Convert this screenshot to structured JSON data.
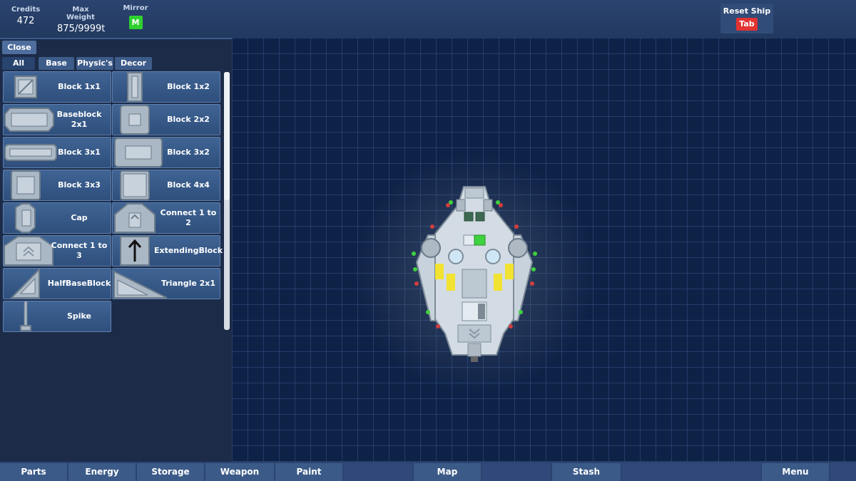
{
  "topbar": {
    "credits_label": "Credits",
    "credits_value": "472",
    "weight_label": "Max Weight",
    "weight_value": "875/9999t",
    "mirror_label": "Mirror",
    "mirror_key": "M",
    "mirror_color": "#2fd12f",
    "reset_label": "Reset Ship",
    "reset_key": "Tab",
    "reset_color": "#e23232"
  },
  "panel": {
    "close_label": "Close",
    "tabs": [
      "All",
      "Base",
      "Physic's",
      "Decor"
    ],
    "active_tab": "All",
    "parts": [
      {
        "label": "Block 1x1",
        "icon": "block-1x1-icon"
      },
      {
        "label": "Block 1x2",
        "icon": "block-1x2-icon"
      },
      {
        "label": "Baseblock 2x1",
        "icon": "baseblock-2x1-icon"
      },
      {
        "label": "Block 2x2",
        "icon": "block-2x2-icon"
      },
      {
        "label": "Block 3x1",
        "icon": "block-3x1-icon"
      },
      {
        "label": "Block 3x2",
        "icon": "block-3x2-icon"
      },
      {
        "label": "Block 3x3",
        "icon": "block-3x3-icon"
      },
      {
        "label": "Block 4x4",
        "icon": "block-4x4-icon"
      },
      {
        "label": "Cap",
        "icon": "cap-icon"
      },
      {
        "label": "Connect 1 to 2",
        "icon": "connect-1-to-2-icon"
      },
      {
        "label": "Connect 1 to 3",
        "icon": "connect-1-to-3-icon"
      },
      {
        "label": "ExtendingBlock",
        "icon": "extending-block-icon"
      },
      {
        "label": "HalfBaseBlock",
        "icon": "half-base-block-icon"
      },
      {
        "label": "Triangle 2x1",
        "icon": "triangle-2x1-icon"
      },
      {
        "label": "Spike",
        "icon": "spike-icon"
      }
    ]
  },
  "bottombar": {
    "buttons": [
      "Parts",
      "Energy",
      "Storage",
      "Weapon",
      "Paint",
      "Map",
      "Stash",
      "Menu"
    ]
  },
  "colors": {
    "panel_button": "#3f6494",
    "grid_background": "#0e2247",
    "thruster_green": "#3ed23e",
    "thruster_red": "#d23e3e",
    "energy_yellow": "#f2e232"
  }
}
